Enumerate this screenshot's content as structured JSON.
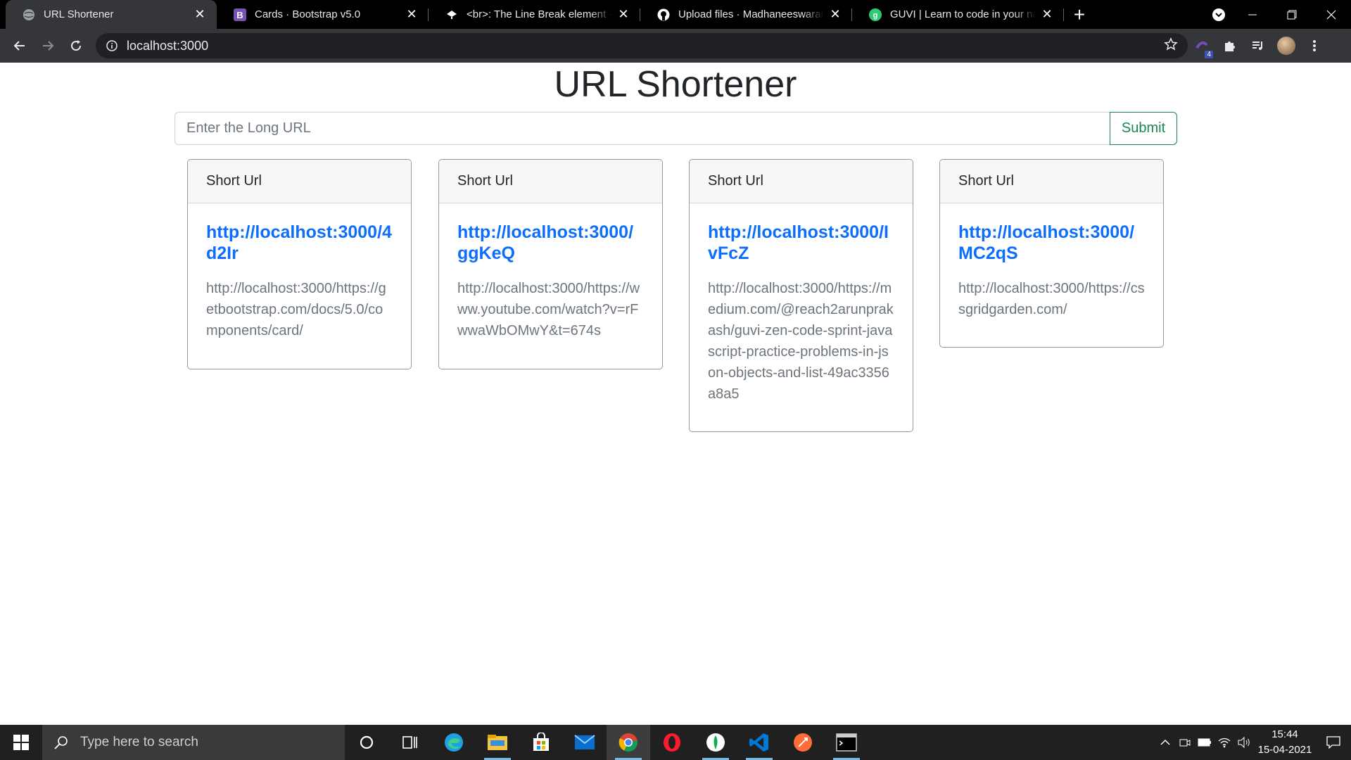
{
  "browser": {
    "tabs": [
      {
        "title": "URL Shortener",
        "icon": "globe-icon",
        "active": true
      },
      {
        "title": "Cards · Bootstrap v5.0",
        "icon": "bootstrap-icon",
        "active": false
      },
      {
        "title": "<br>: The Line Break element - H",
        "icon": "mdn-icon",
        "active": false
      },
      {
        "title": "Upload files · MadhaneeswaranP",
        "icon": "github-icon",
        "active": false
      },
      {
        "title": "GUVI | Learn to code in your nati",
        "icon": "guvi-icon",
        "active": false
      }
    ],
    "address": "localhost:3000",
    "extension_badge": "4",
    "colors": {
      "tabbar": "#000000",
      "toolbar": "#35363a",
      "omnibox": "#202124"
    }
  },
  "page": {
    "title": "URL Shortener",
    "input_placeholder": "Enter the Long URL",
    "submit_label": "Submit",
    "colors": {
      "link": "#0d6efd",
      "submit": "#198754",
      "muted": "#6c757d"
    }
  },
  "cards": [
    {
      "header": "Short Url",
      "short": "http://localhost:3000/4d2Ir",
      "long": "http://localhost:3000/https://getbootstrap.com/docs/5.0/components/card/"
    },
    {
      "header": "Short Url",
      "short": "http://localhost:3000/ggKeQ",
      "long": "http://localhost:3000/https://www.youtube.com/watch?v=rFwwaWbOMwY&t=674s"
    },
    {
      "header": "Short Url",
      "short": "http://localhost:3000/IvFcZ",
      "long": "http://localhost:3000/https://medium.com/@reach2arunprakash/guvi-zen-code-sprint-javascript-practice-problems-in-json-objects-and-list-49ac3356a8a5"
    },
    {
      "header": "Short Url",
      "short": "http://localhost:3000/MC2qS",
      "long": "http://localhost:3000/https://cssgridgarden.com/"
    }
  ],
  "taskbar": {
    "search_placeholder": "Type here to search",
    "time": "15:44",
    "date": "15-04-2021",
    "apps": [
      "cortana-icon",
      "task-view-icon",
      "edge-icon",
      "file-explorer-icon",
      "store-icon",
      "mail-icon",
      "chrome-icon",
      "opera-icon",
      "mongodb-compass-icon",
      "vscode-icon",
      "postman-icon",
      "terminal-icon"
    ]
  }
}
